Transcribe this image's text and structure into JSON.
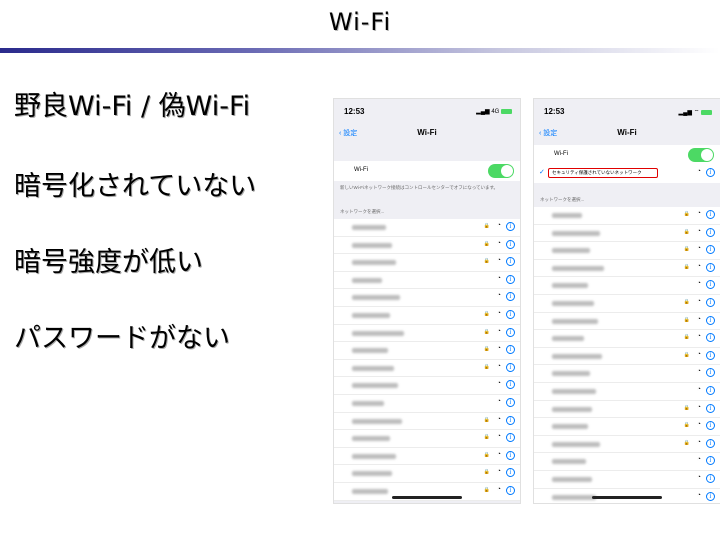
{
  "slide": {
    "title": "Wi-Fi",
    "bullets": [
      "野良Wi-Fi / 偽Wi-Fi",
      "暗号化されていない",
      "暗号強度が低い",
      "パスワードがない"
    ]
  },
  "phones": [
    {
      "time": "12:53",
      "signal": "4G",
      "back_label": "設定",
      "nav_title": "Wi-Fi",
      "toggle_label": "Wi-Fi",
      "note": "新しいWi-Fiネットワーク接続はコントロールセンターでオフになっています。",
      "section_label": "ネットワークを選択...",
      "locks": [
        true,
        true,
        true,
        false,
        false,
        true,
        true,
        true,
        true,
        false,
        false,
        true,
        true,
        true,
        true,
        true
      ]
    },
    {
      "time": "12:53",
      "signal": "",
      "back_label": "設定",
      "nav_title": "Wi-Fi",
      "toggle_label": "Wi-Fi",
      "connected_network": "セキュリティ保護されていないネットワーク",
      "section_label": "ネットワークを選択...",
      "locks": [
        true,
        true,
        true,
        true,
        false,
        true,
        true,
        true,
        true,
        false,
        false,
        true,
        true,
        true,
        false,
        false,
        false
      ]
    }
  ],
  "colors": {
    "accent": "#007aff",
    "toggle": "#4cd964",
    "warning": "#e00000",
    "title_bar": "#2a2a8c"
  }
}
